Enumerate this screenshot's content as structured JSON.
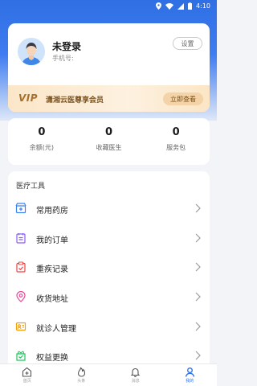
{
  "status_bar": {
    "time": "4:10"
  },
  "profile": {
    "name": "未登录",
    "phone_label": "手机号:",
    "settings_label": "设置"
  },
  "vip": {
    "logo": "VIP",
    "text": "潇湘云医尊享会员",
    "button": "立即查看"
  },
  "stats": [
    {
      "value": "0",
      "label": "余额(元)"
    },
    {
      "value": "0",
      "label": "收藏医生"
    },
    {
      "value": "0",
      "label": "服务包"
    }
  ],
  "tools": {
    "title": "医疗工具",
    "items": [
      {
        "label": "常用药房",
        "icon": "pharmacy-icon",
        "color": "#3b82f6"
      },
      {
        "label": "我的订单",
        "icon": "order-icon",
        "color": "#8b5cf6"
      },
      {
        "label": "重疾记录",
        "icon": "record-icon",
        "color": "#ef4444"
      },
      {
        "label": "收货地址",
        "icon": "location-icon",
        "color": "#ec4899"
      },
      {
        "label": "就诊人管理",
        "icon": "patient-icon",
        "color": "#f59e0b"
      },
      {
        "label": "权益更换",
        "icon": "gift-icon",
        "color": "#22c55e"
      }
    ]
  },
  "tabs": [
    {
      "label": "首页",
      "icon": "home-icon"
    },
    {
      "label": "头条",
      "icon": "fire-icon"
    },
    {
      "label": "消息",
      "icon": "bell-icon"
    },
    {
      "label": "我的",
      "icon": "user-icon",
      "active": true
    }
  ],
  "colors": {
    "primary": "#2f6fe4",
    "vip_gold": "#a8702c"
  }
}
